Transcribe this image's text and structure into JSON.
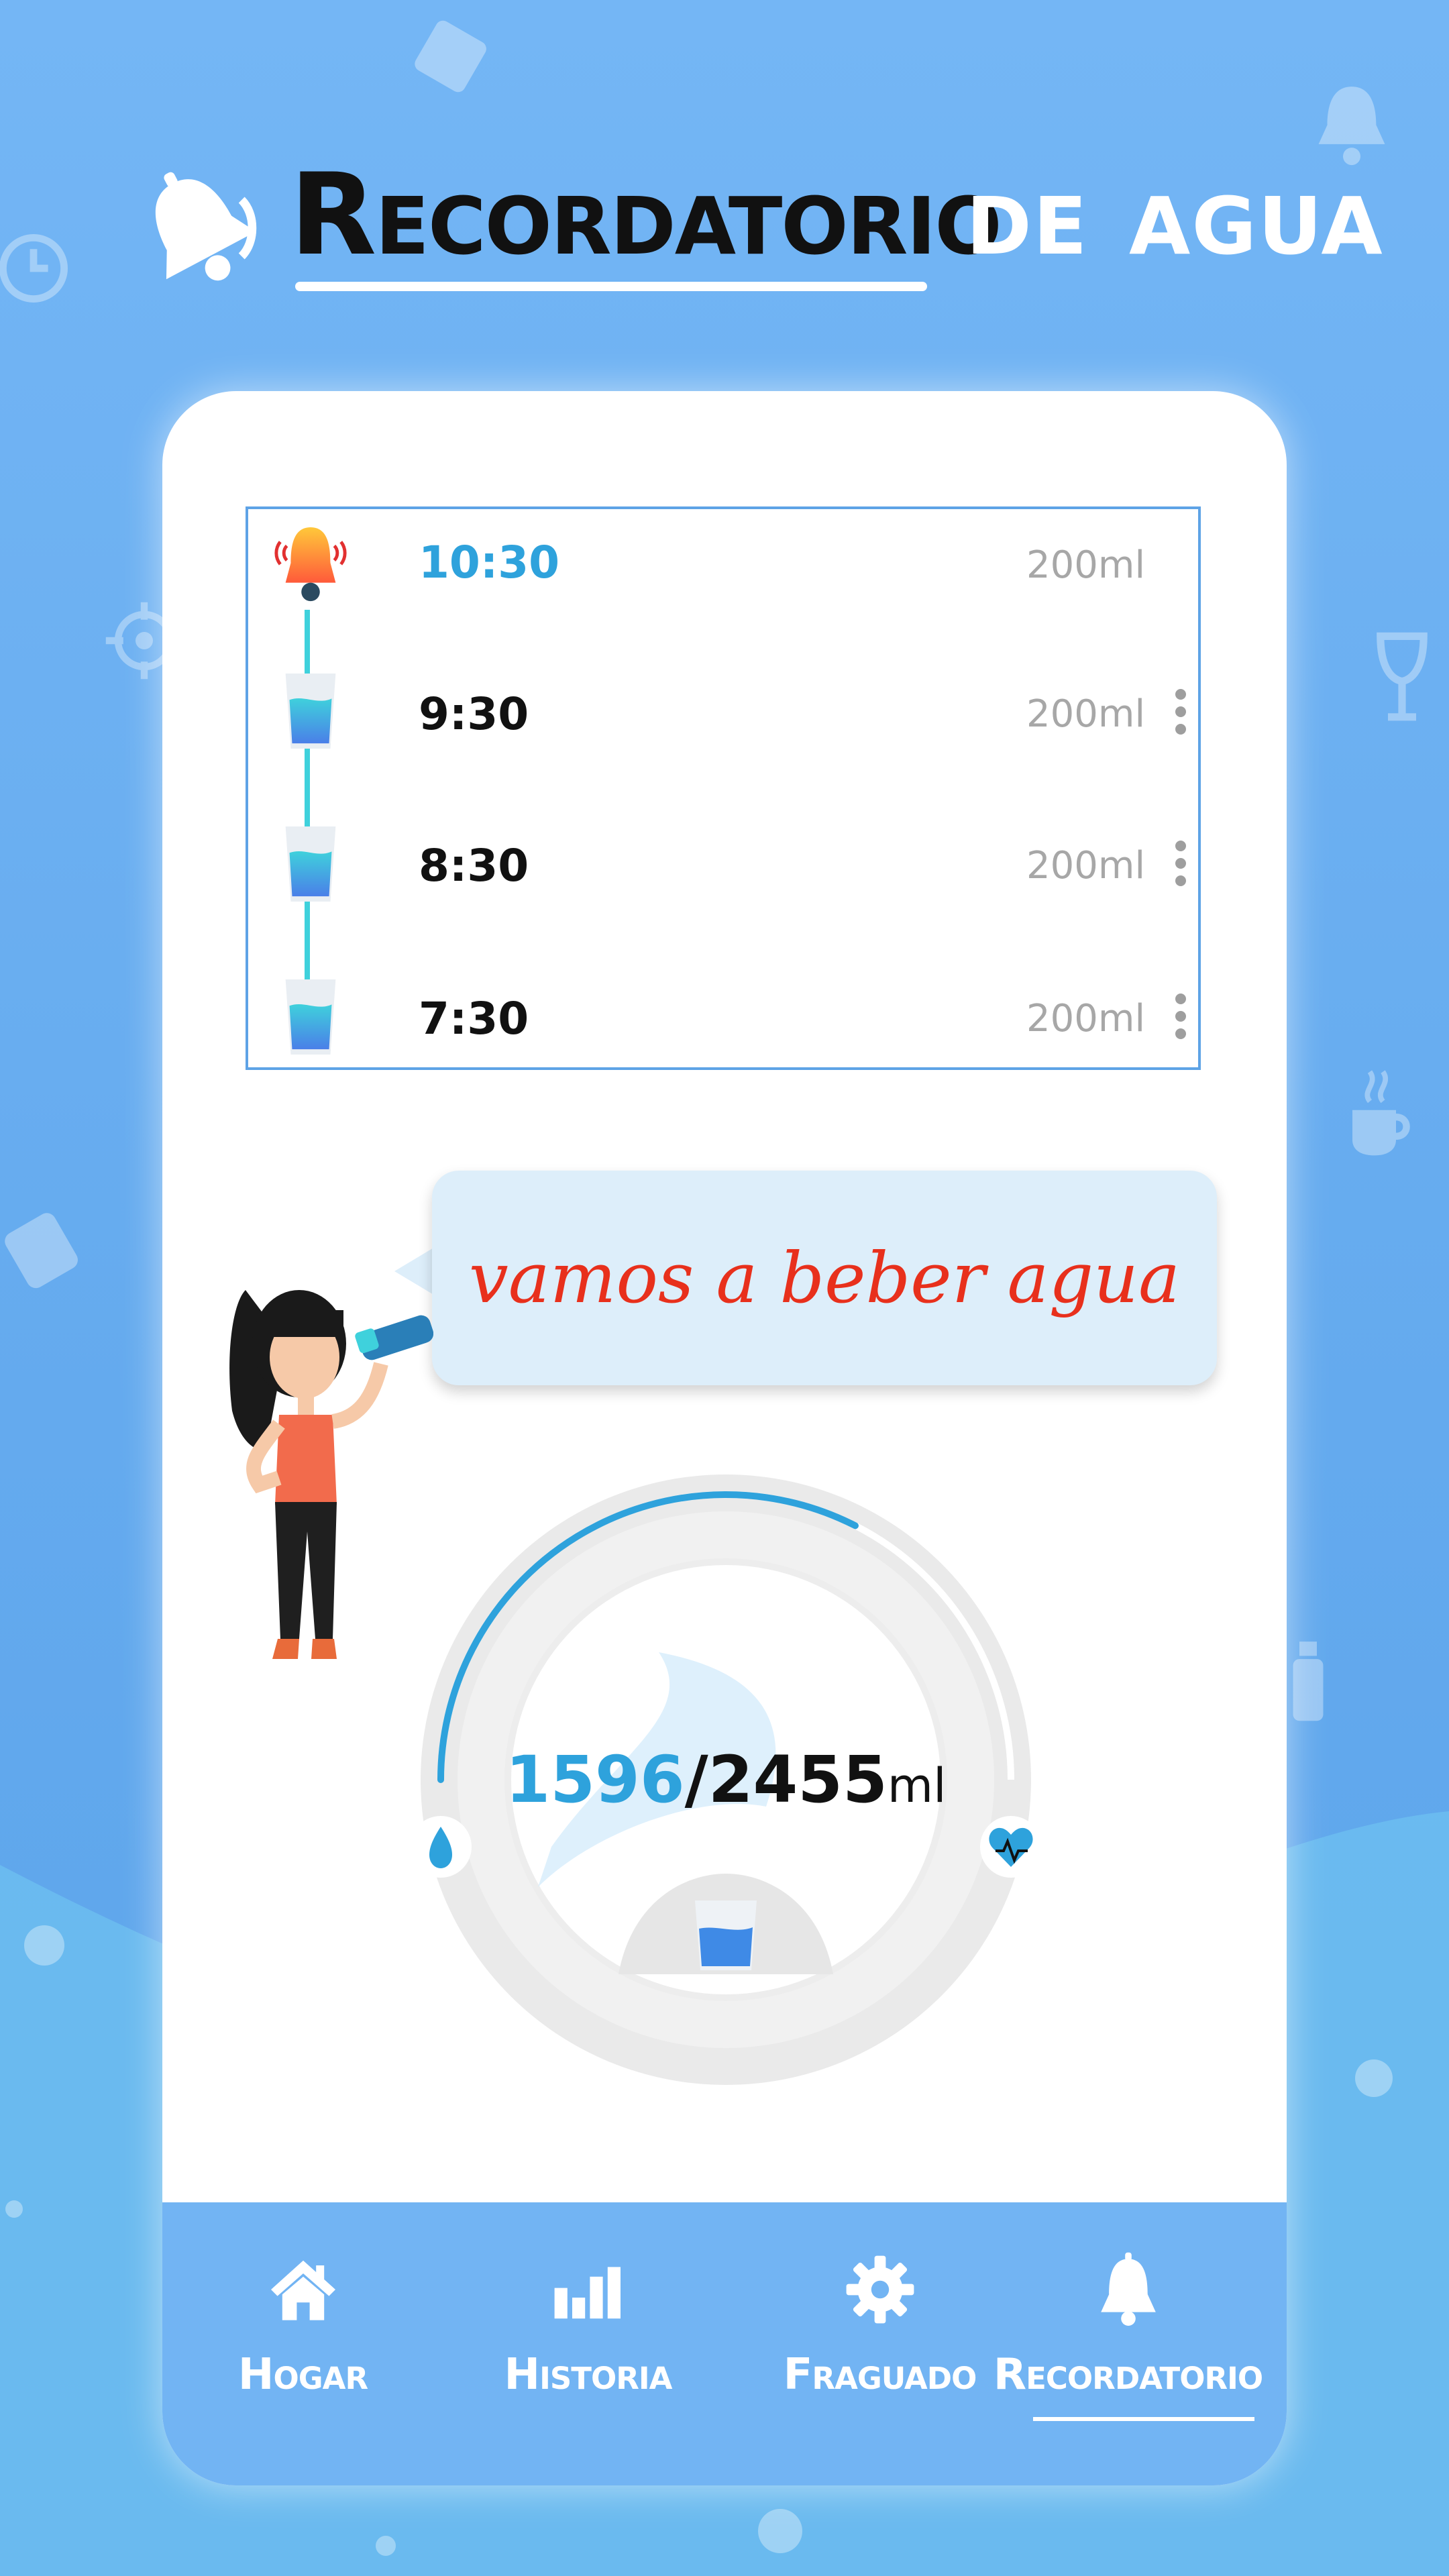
{
  "header": {
    "title_part1": "Recordatorio",
    "title_part2": "de agua",
    "bell_icon": "bell-icon"
  },
  "reminders": [
    {
      "time": "10:30",
      "amount": "200ml",
      "icon": "alarm-bell-icon",
      "next": true
    },
    {
      "time": "9:30",
      "amount": "200ml",
      "icon": "water-glass-icon",
      "next": false
    },
    {
      "time": "8:30",
      "amount": "200ml",
      "icon": "water-glass-icon",
      "next": false
    },
    {
      "time": "7:30",
      "amount": "200ml",
      "icon": "water-glass-icon",
      "next": false
    }
  ],
  "speech": {
    "text": "vamos a beber agua"
  },
  "progress": {
    "current": "1596",
    "separator": "/",
    "goal": "2455",
    "unit": "ml",
    "fraction": 0.65
  },
  "nav": {
    "items": [
      {
        "label": "Hogar",
        "icon": "home-icon",
        "active": false
      },
      {
        "label": "Historia",
        "icon": "bar-chart-icon",
        "active": false
      },
      {
        "label": "Fraguado",
        "icon": "gear-icon",
        "active": false
      },
      {
        "label": "Recordatorio",
        "icon": "bell-icon",
        "active": true
      }
    ]
  },
  "colors": {
    "accent": "#2ea2dc",
    "speech_text": "#e8301c",
    "background": "#6aaff0",
    "nav": "#72b4f3"
  }
}
